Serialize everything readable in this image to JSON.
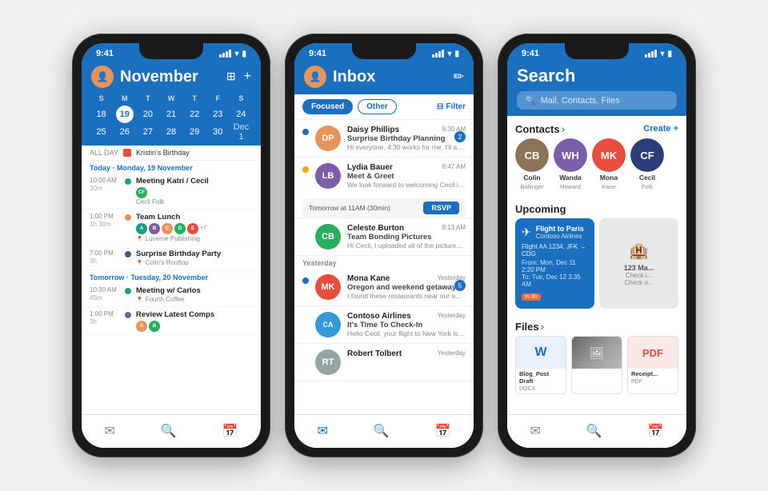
{
  "phones": {
    "calendar": {
      "status_time": "9:41",
      "title": "November",
      "dow": [
        "S",
        "M",
        "T",
        "W",
        "T",
        "F",
        "S"
      ],
      "weeks": [
        [
          "18",
          "19",
          "20",
          "21",
          "22",
          "23",
          "24"
        ],
        [
          "25",
          "26",
          "27",
          "28",
          "29",
          "30",
          "1"
        ]
      ],
      "today_cell": "19",
      "dec_cell": "1",
      "allday_label": "ALL DAY",
      "allday_event": "Kristin's Birthday",
      "today_label": "Today · Monday, 19 November",
      "events": [
        {
          "time": "10:00 AM",
          "dur": "30m",
          "title": "Meeting Katri / Cecil",
          "sub": "Cecil Folk",
          "color": "av-teal",
          "has_avatars": true
        },
        {
          "time": "1:00 PM",
          "dur": "1h 30m",
          "title": "Team Lunch",
          "location": "Lucerne Publishing",
          "color": "av-orange",
          "has_avatars": true
        },
        {
          "time": "7:00 PM",
          "dur": "3h",
          "title": "Surprise Birthday Party",
          "location": "Colin's Rooftop",
          "color": "av-blue"
        }
      ],
      "tomorrow_label": "Tomorrow · Tuesday, 20 November",
      "tomorrow_events": [
        {
          "time": "10:30 AM",
          "dur": "45m",
          "title": "Meeting w/ Carlos",
          "location": "Fourth Coffee",
          "color": "av-teal"
        },
        {
          "time": "1:00 PM",
          "dur": "3h",
          "title": "Review Latest Comps",
          "color": "av-purple",
          "has_avatars": true
        }
      ],
      "tabs": [
        "mail",
        "search",
        "calendar"
      ]
    },
    "inbox": {
      "status_time": "9:41",
      "title": "Inbox",
      "filter_focused": "Focused",
      "filter_other": "Other",
      "filter_label": "Filter",
      "emails": [
        {
          "name": "Daisy Phillips",
          "subject": "Surprise Birthday Planning",
          "preview": "Hi everyone, 4:30 works for me, I'll arrange for Mauricio to arrive aroun...",
          "time": "9:30 AM",
          "initials": "DP",
          "color": "av-orange",
          "badge": "2"
        },
        {
          "name": "Lydia Bauer",
          "subject": "Meet & Greet",
          "preview": "We look forward to welcoming Cecil in...",
          "time": "8:47 AM",
          "initials": "LB",
          "color": "av-purple",
          "rsvp": "Tomorrow at 11AM (30min)"
        },
        {
          "name": "Celeste Burton",
          "subject": "Team Bonding Pictures",
          "preview": "Hi Cecil, I uploaded all of the pictures from last weekend to our OneDrive. I'll l...",
          "time": "8:13 AM",
          "initials": "CB",
          "color": "av-green"
        }
      ],
      "yesterday_label": "Yesterday",
      "yesterday_emails": [
        {
          "name": "Mona Kane",
          "subject": "Oregon and weekend getaway",
          "preview": "I found these restaurants near our apartment. What do you think? I like",
          "time": "Yesterday",
          "initials": "MK",
          "color": "av-red",
          "badge": "5"
        },
        {
          "name": "Contoso Airlines",
          "subject": "It's Time To Check-In",
          "preview": "Hello Cecil, your flight to New York is departing tomorrow at 15:00 o'clock fro...",
          "time": "Yesterday",
          "initials": "CA",
          "color": "av-ca"
        },
        {
          "name": "Robert Tolbert",
          "subject": "",
          "preview": "",
          "time": "Yesterday",
          "initials": "RT",
          "color": "av-gray"
        }
      ],
      "tabs": [
        "mail",
        "search",
        "calendar"
      ]
    },
    "search": {
      "status_time": "9:41",
      "title": "Search",
      "search_placeholder": "Mail, Contacts, Files",
      "contacts_label": "Contacts",
      "contacts_chevron": "›",
      "create_label": "Create +",
      "contacts": [
        {
          "name": "Colin",
          "last": "Ballinger",
          "initials": "CB",
          "color": "av-brown"
        },
        {
          "name": "Wanda",
          "last": "Howard",
          "initials": "WH",
          "color": "av-purple"
        },
        {
          "name": "Mona",
          "last": "Kane",
          "initials": "MK",
          "color": "av-red"
        },
        {
          "name": "Cecil",
          "last": "Folk",
          "initials": "CF",
          "color": "av-darkblue"
        }
      ],
      "upcoming_label": "Upcoming",
      "flight_title": "Flight to Paris",
      "flight_sub": "Contoso Airlines",
      "flight_num": "Flight AA 1234, JFK → CDG",
      "flight_from": "From: Mon, Dec 11 2:20 PM",
      "flight_to": "To: Tue, Dec 12 3:35 AM",
      "flight_badge": "In 3h",
      "card2_title": "123 Ma...",
      "card2_line1": "Check i...",
      "card2_line2": "Check o...",
      "files_label": "Files",
      "files_chevron": "›",
      "files": [
        {
          "name": "Blog_Post Draft",
          "type": "DOCX",
          "icon": "W"
        },
        {
          "name": "",
          "type": "",
          "icon": "📷"
        },
        {
          "name": "Receipt...",
          "type": "PDF",
          "icon": "📄"
        }
      ],
      "tabs": [
        "mail",
        "search",
        "calendar"
      ]
    }
  }
}
